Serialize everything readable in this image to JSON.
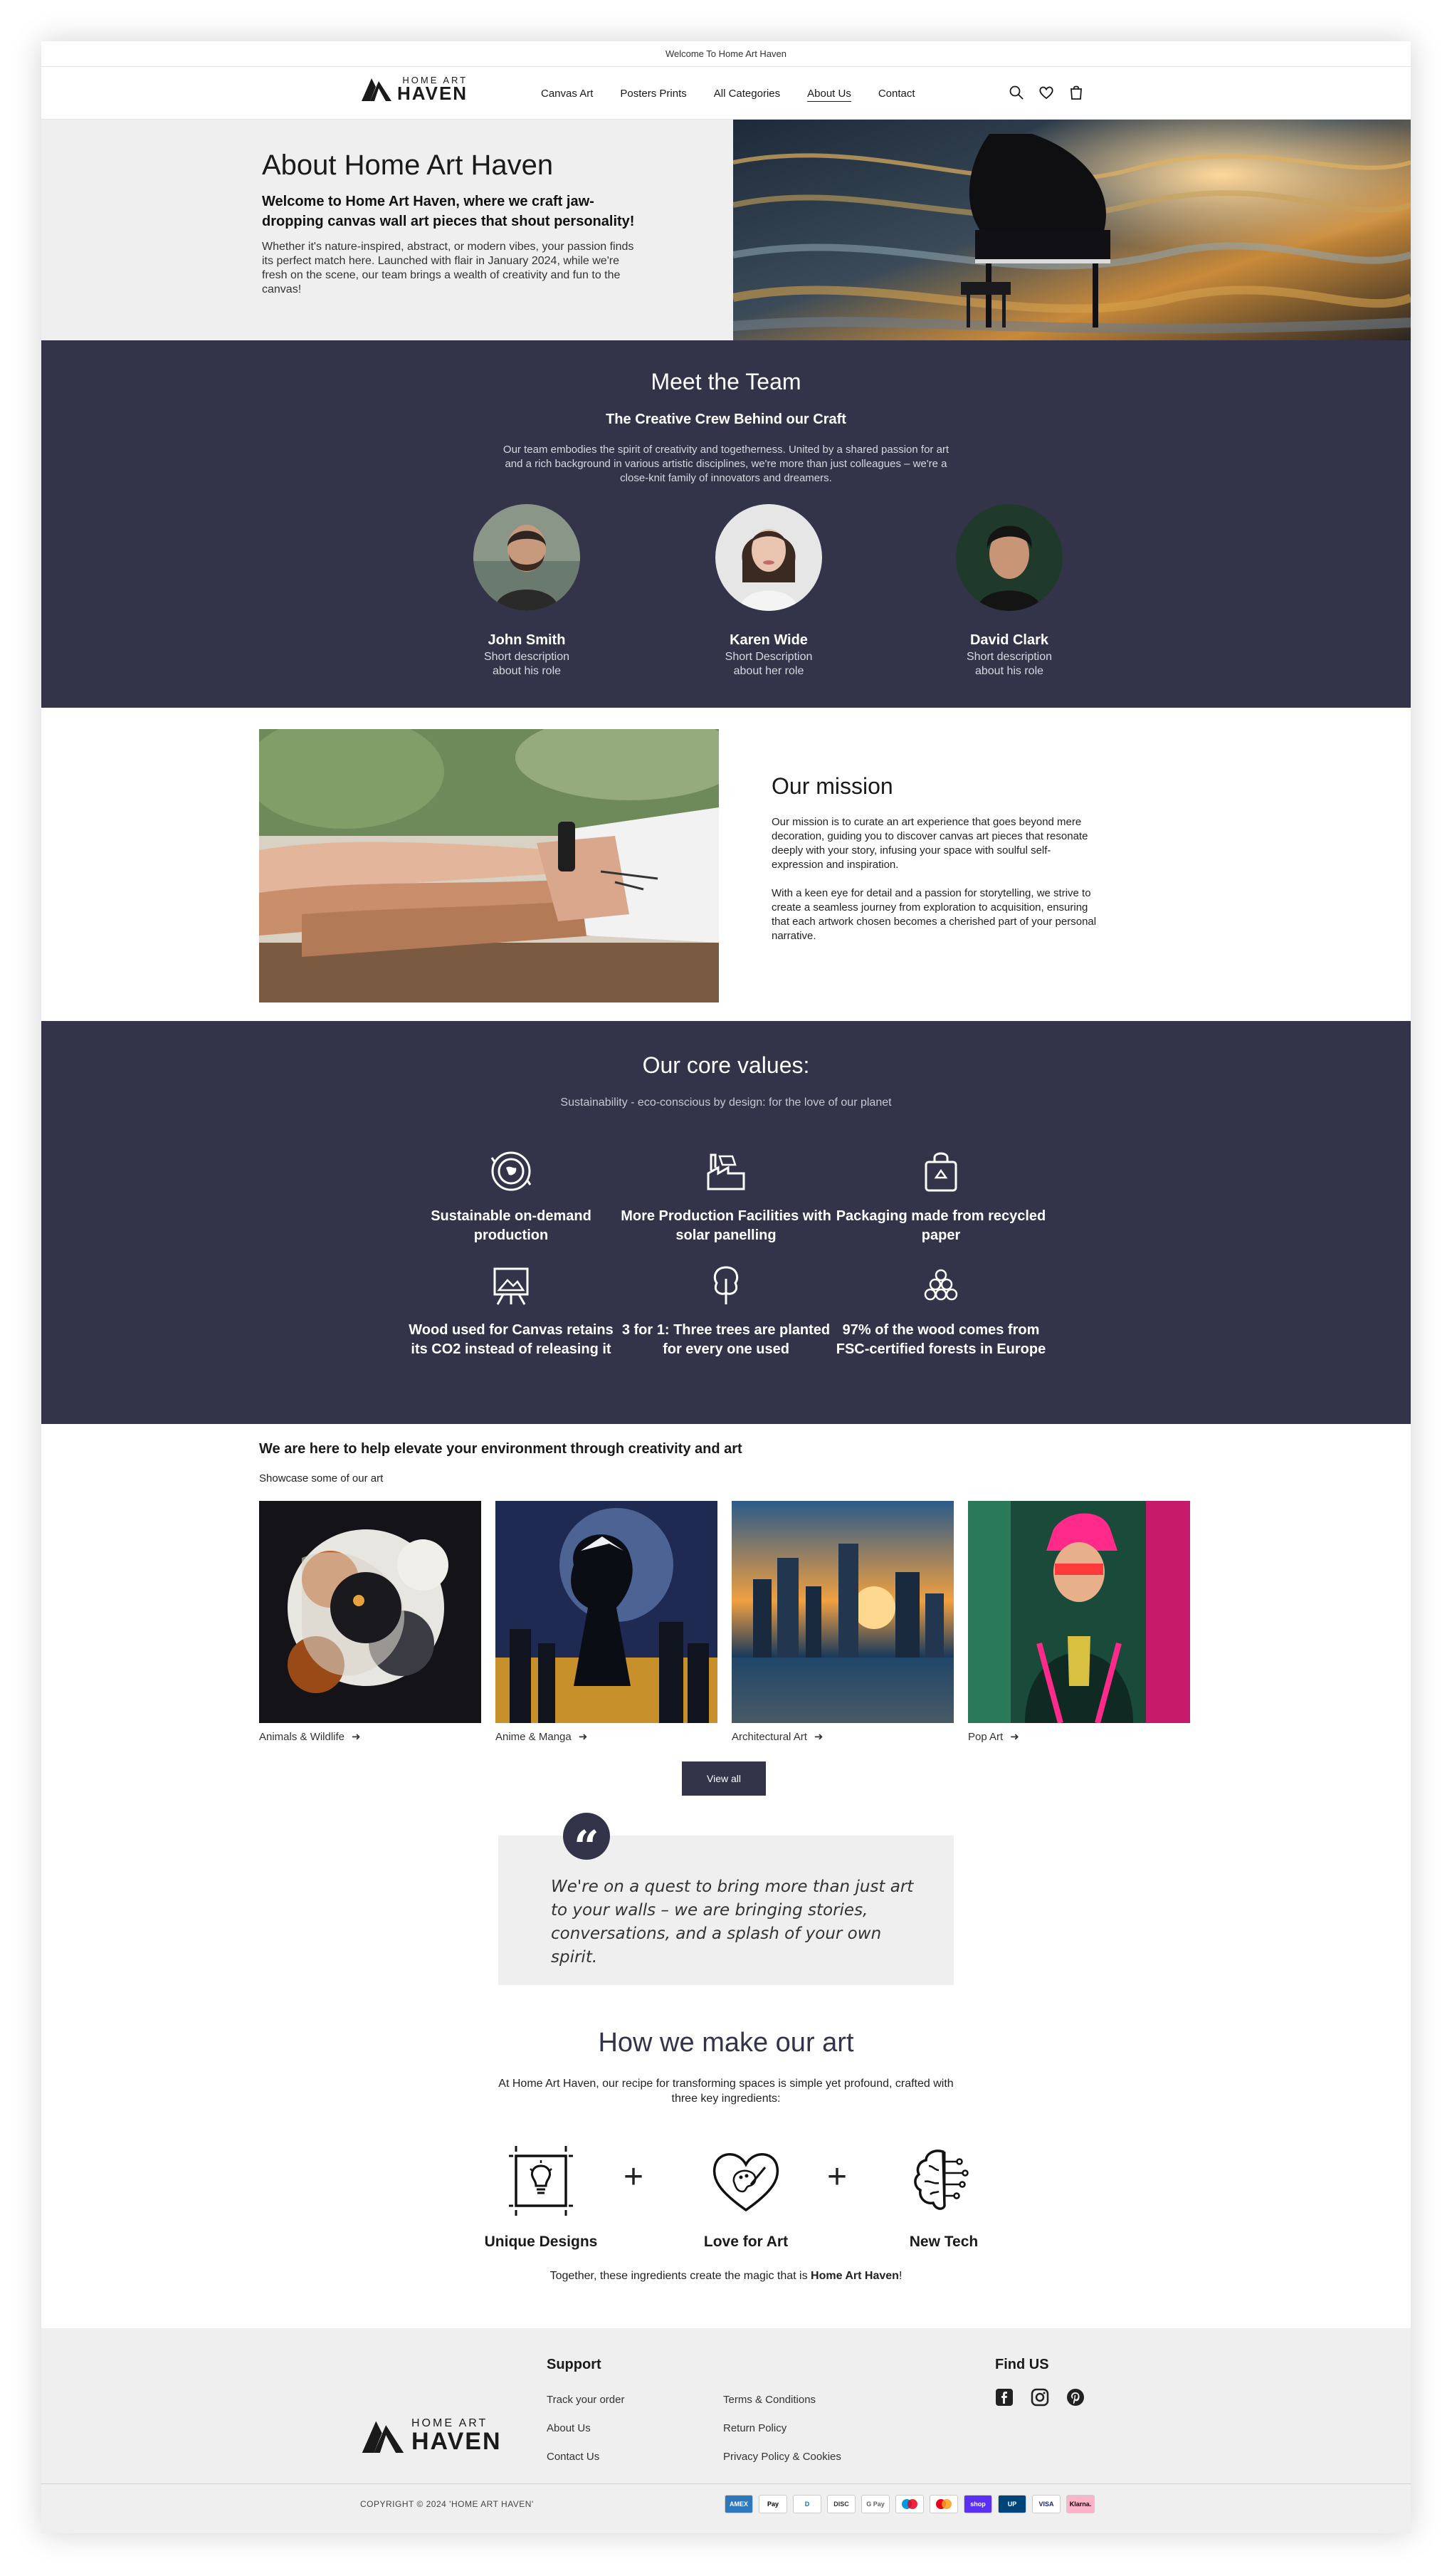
{
  "announcement": "Welcome To Home Art Haven",
  "logo": {
    "small": "HOME ART",
    "big": "HAVEN"
  },
  "nav": [
    "Canvas Art",
    "Posters Prints",
    "All Categories",
    "About Us",
    "Contact"
  ],
  "header_icons": [
    "search-icon",
    "heart-icon",
    "cart-icon"
  ],
  "about": {
    "title": "About Home Art Haven",
    "lead": "Welcome to Home Art Haven, where we craft jaw-dropping canvas wall art pieces that shout personality!",
    "body": "Whether it's nature-inspired, abstract, or modern vibes, your passion finds its perfect match here. Launched with flair in January 2024, while we're fresh on the scene, our team brings a wealth of creativity and fun to the canvas!"
  },
  "team": {
    "title": "Meet the Team",
    "subtitle": "The Creative Crew Behind our Craft",
    "intro": "Our team embodies the spirit of creativity and togetherness. United by a shared passion for art and a rich background in various artistic disciplines, we're more than just colleagues – we're a close-knit family of innovators and dreamers.",
    "members": [
      {
        "name": "John Smith",
        "desc": "Short description about his role"
      },
      {
        "name": "Karen Wide",
        "desc": "Short Description about her role"
      },
      {
        "name": "David Clark",
        "desc": "Short description about his role"
      }
    ]
  },
  "mission": {
    "title": "Our mission",
    "p1": "Our mission is to curate an art experience that goes beyond mere decoration, guiding you to discover canvas art pieces that resonate deeply with your story, infusing your space with soulful self-expression and inspiration.",
    "p2": "With a keen eye for detail and a passion for storytelling, we strive to create a seamless journey from exploration to acquisition, ensuring that each artwork chosen becomes a cherished part of your personal narrative."
  },
  "values": {
    "title": "Our core values:",
    "subtitle": "Sustainability - eco-conscious by design: for the love of our planet",
    "items": [
      {
        "label": "Sustainable on-demand production",
        "icon": "earth-cycle-icon"
      },
      {
        "label": "More Production Facilities with solar panelling",
        "icon": "solar-factory-icon"
      },
      {
        "label": "Packaging made from recycled paper",
        "icon": "recycled-bag-icon"
      },
      {
        "label": "Wood used for Canvas retains its CO2 instead of releasing it",
        "icon": "canvas-easel-icon"
      },
      {
        "label": "3 for 1: Three trees are planted for every one used",
        "icon": "tree-icon"
      },
      {
        "label": "97% of the wood comes from FSC-certified forests in Europe",
        "icon": "wood-logs-icon"
      }
    ]
  },
  "showcase": {
    "title": "We are here to help elevate your environment through creativity and art",
    "subtitle": "Showcase some of our art",
    "items": [
      {
        "label": "Animals & Wildlife"
      },
      {
        "label": "Anime & Manga"
      },
      {
        "label": "Architectural Art"
      },
      {
        "label": "Pop Art"
      }
    ],
    "view_all": "View all"
  },
  "quote": "We're on a quest to bring more than just art to your walls – we are bringing stories, conversations, and a splash of your own spirit.",
  "how": {
    "title": "How we make our art",
    "subtitle": "At Home Art Haven, our recipe for transforming spaces is simple yet profound, crafted with three key ingredients:",
    "ingredients": [
      "Unique Designs",
      "Love for Art",
      "New Tech"
    ],
    "plus": "+",
    "together_prefix": "Together, these ingredients create the magic that is ",
    "together_brand": "Home Art Haven",
    "together_suffix": "!"
  },
  "footer": {
    "support_title": "Support",
    "support_links": [
      "Track your order",
      "About Us",
      "Contact Us"
    ],
    "legal_links": [
      "Terms & Conditions",
      "Return Policy",
      "Privacy Policy & Cookies"
    ],
    "find_title": "Find US",
    "social": [
      "facebook-icon",
      "instagram-icon",
      "pinterest-icon"
    ],
    "copyright": "COPYRIGHT © 2024 'HOME ART HAVEN'",
    "payments": [
      {
        "label": "AMEX",
        "bg": "#2e77bc",
        "fg": "#ffffff"
      },
      {
        "label": "Pay",
        "bg": "#ffffff",
        "fg": "#000000"
      },
      {
        "label": "D",
        "bg": "#ffffff",
        "fg": "#0079be"
      },
      {
        "label": "DISC",
        "bg": "#ffffff",
        "fg": "#333333"
      },
      {
        "label": "G Pay",
        "bg": "#ffffff",
        "fg": "#5f6368"
      },
      {
        "label": "",
        "bg": "#ffffff",
        "fg": "#333333"
      },
      {
        "label": "",
        "bg": "#ffffff",
        "fg": "#333333"
      },
      {
        "label": "shop",
        "bg": "#5a31f4",
        "fg": "#ffffff"
      },
      {
        "label": "UP",
        "bg": "#00447c",
        "fg": "#ffffff"
      },
      {
        "label": "VISA",
        "bg": "#ffffff",
        "fg": "#1a1f71"
      },
      {
        "label": "Klarna.",
        "bg": "#ffb3c7",
        "fg": "#000000"
      }
    ]
  },
  "colors": {
    "dark": "#33334a",
    "light": "#efefef"
  }
}
